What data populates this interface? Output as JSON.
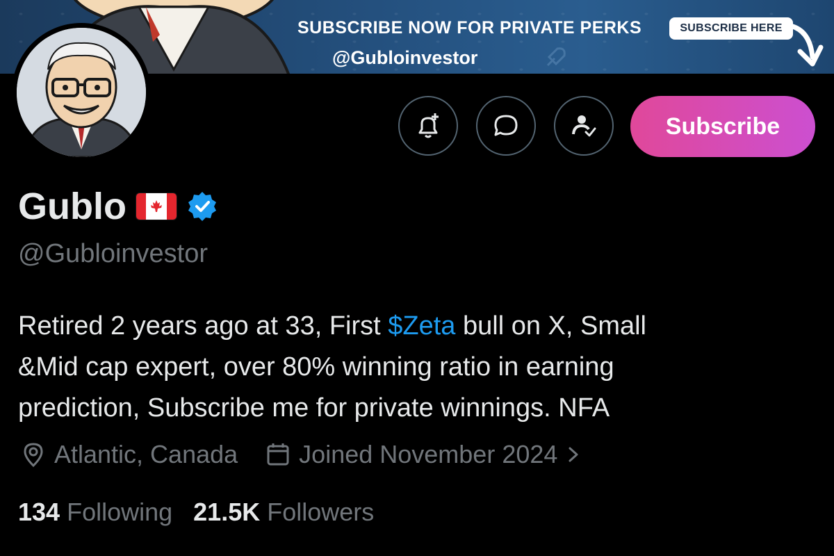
{
  "banner": {
    "title": "SUBSCRIBE NOW FOR PRIVATE PERKS",
    "handle": "@Gubloinvestor",
    "button_label": "SUBSCRIBE HERE"
  },
  "profile": {
    "name": "Gublo",
    "flag": "canada-flag",
    "verified": true,
    "handle": "@Gubloinvestor",
    "bio": {
      "before_cashtag": "Retired 2 years ago at 33, First ",
      "cashtag": "$Zeta",
      "after_cashtag_line1": " bull on X, Small",
      "line2": "&Mid cap expert, over 80% winning ratio in earning",
      "line3": "prediction, Subscribe me for private winnings. NFA"
    },
    "location": "Atlantic, Canada",
    "joined": "Joined November 2024",
    "following_count": "134",
    "following_label": "Following",
    "followers_count": "21.5K",
    "followers_label": "Followers"
  },
  "actions": {
    "subscribe_label": "Subscribe",
    "icons": [
      "bell-plus-icon",
      "message-icon",
      "person-check-icon"
    ]
  },
  "colors": {
    "background": "#000000",
    "text": "#e7e9ea",
    "muted": "#71767b",
    "link": "#1d9bf0",
    "verified": "#1d9bf0",
    "subscribe_gradient_start": "#e0489a",
    "subscribe_gradient_end": "#cc4fd0"
  }
}
